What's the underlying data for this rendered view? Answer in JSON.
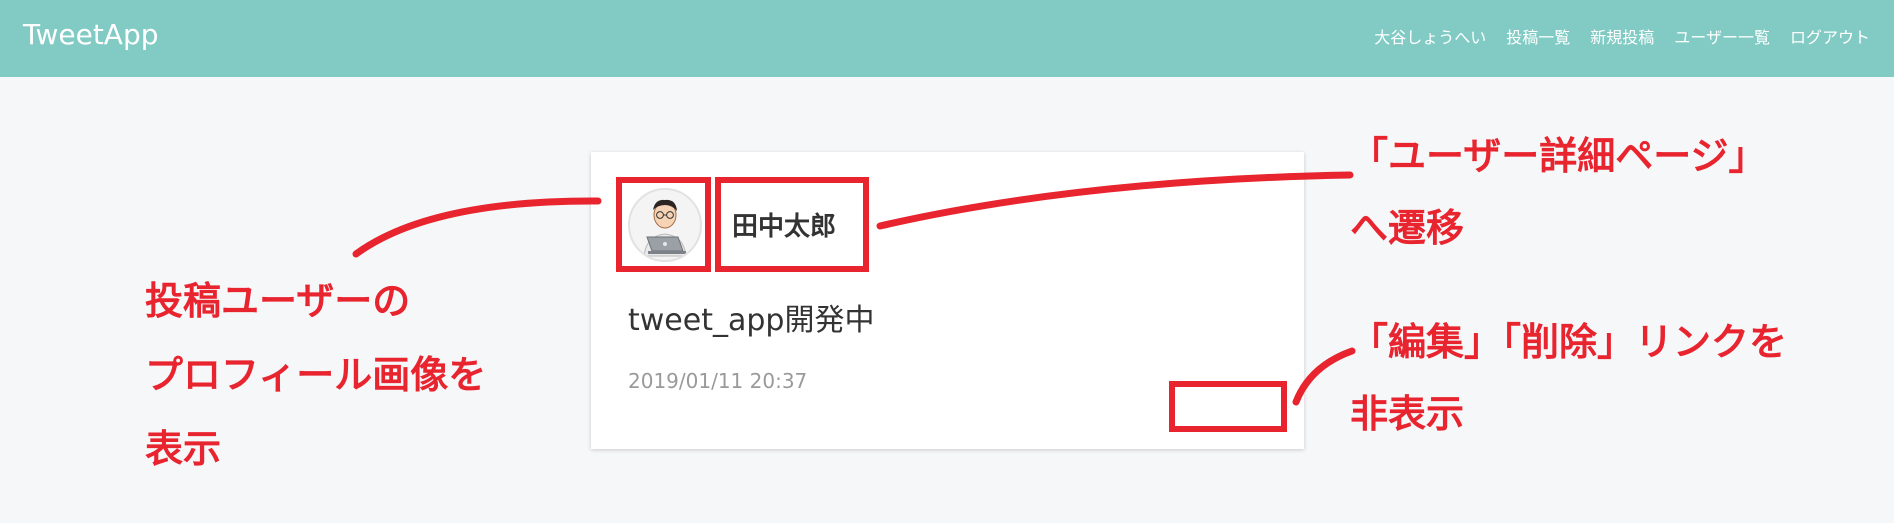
{
  "header": {
    "brand": "TweetApp",
    "nav": [
      "大谷しょうへい",
      "投稿一覧",
      "新規投稿",
      "ユーザー一覧",
      "ログアウト"
    ]
  },
  "card": {
    "user_name": "田中太郎",
    "tweet_text": "tweet_app開発中",
    "date": "2019/01/11 20:37"
  },
  "annotations": {
    "left": [
      "投稿ユーザーの",
      "プロフィール画像を",
      "表示"
    ],
    "right_top": [
      "「ユーザー詳細ページ」",
      "へ遷移"
    ],
    "right_bottom": [
      "「編集」「削除」リンクを",
      "非表示"
    ]
  },
  "colors": {
    "header_bg": "#81cbc4",
    "page_bg": "#f6f7f9",
    "annotation_red": "#e8242f"
  },
  "icons": {
    "avatar": "user-avatar-with-laptop"
  }
}
